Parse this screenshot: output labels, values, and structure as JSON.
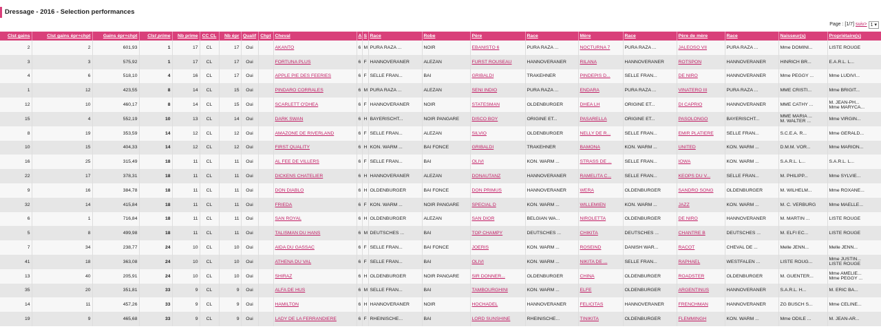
{
  "page": {
    "title": "Dressage - 2016 - Selection performances"
  },
  "pager": {
    "label": "Page : [1/7]",
    "next_label": "suiv>",
    "selected": "1"
  },
  "columns": [
    "Clst gains",
    "Clst gains épr+chpt",
    "Gains épr+chpt",
    "Clst prime",
    "Nb prime",
    "CC CL",
    "Nb épr",
    "Qualif",
    "Chpt",
    "Cheval",
    "A",
    "S",
    "Race",
    "Robe",
    "Père",
    "Race",
    "Mère",
    "Race",
    "Père de mère",
    "Race",
    "Naisseur(s)",
    "Propriétaire(s)"
  ],
  "rows": [
    {
      "clst": "2",
      "clst_ec": "2",
      "gains": "601,93",
      "clst_prime": "1",
      "nb_prime": "17",
      "cc": "CL",
      "nb_epr": "17",
      "qualif": "Oui",
      "chpt": "",
      "cheval": "AKANTO",
      "a": "6",
      "s": "M",
      "race": "PURA RAZA ...",
      "robe": "NOIR",
      "pere": "EBANISTO 6",
      "race_pere": "PURA RAZA ...",
      "mere": "NOCTURNA 7",
      "race_mere": "PURA RAZA ...",
      "pdm": "JALEOSO VII",
      "race_pdm": "PURA RAZA ...",
      "naisseur": "Mme DOMINI...",
      "proprietaire": "LISTE ROUGE"
    },
    {
      "clst": "3",
      "clst_ec": "3",
      "gains": "575,92",
      "clst_prime": "1",
      "nb_prime": "17",
      "cc": "CL",
      "nb_epr": "17",
      "qualif": "Oui",
      "chpt": "",
      "cheval": "FORTUNA PLUS",
      "a": "6",
      "s": "F",
      "race": "HANNOVERANER",
      "robe": "ALEZAN",
      "pere": "FURST ROUSEAU",
      "race_pere": "HANNOVERANER",
      "mere": "RILANA",
      "race_mere": "HANNOVERANER",
      "pdm": "ROTSPON",
      "race_pdm": "HANNOVERANER",
      "naisseur": "HINRICH BR...",
      "proprietaire": "E.A.R.L. L..."
    },
    {
      "clst": "4",
      "clst_ec": "6",
      "gains": "518,10",
      "clst_prime": "4",
      "nb_prime": "16",
      "cc": "CL",
      "nb_epr": "17",
      "qualif": "Oui",
      "chpt": "",
      "cheval": "APPLE PIE DES FEERIES",
      "a": "6",
      "s": "F",
      "race": "SELLE FRAN...",
      "robe": "BAI",
      "pere": "GRIBALDI",
      "race_pere": "TRAKEHNER",
      "mere": "PINDEPIS D...",
      "race_mere": "SELLE FRAN...",
      "pdm": "DE NIRO",
      "race_pdm": "HANNOVERANER",
      "naisseur": "Mme PEGGY ...",
      "proprietaire": "Mme LUDIVI..."
    },
    {
      "clst": "1",
      "clst_ec": "12",
      "gains": "423,55",
      "clst_prime": "8",
      "nb_prime": "14",
      "cc": "CL",
      "nb_epr": "15",
      "qualif": "Oui",
      "chpt": "",
      "cheval": "PINDARO CORRALES",
      "a": "6",
      "s": "M",
      "race": "PURA RAZA ...",
      "robe": "ALEZAN",
      "pere": "SENI INDIO",
      "race_pere": "PURA RAZA ...",
      "mere": "ENDARA",
      "race_mere": "PURA RAZA ...",
      "pdm": "VINATERO III",
      "race_pdm": "PURA RAZA ...",
      "naisseur": "MME CRISTI...",
      "proprietaire": "Mme BRIGIT..."
    },
    {
      "clst": "12",
      "clst_ec": "10",
      "gains": "460,17",
      "clst_prime": "8",
      "nb_prime": "14",
      "cc": "CL",
      "nb_epr": "15",
      "qualif": "Oui",
      "chpt": "",
      "cheval": "SCARLETT O'DHEA",
      "a": "6",
      "s": "F",
      "race": "HANNOVERANER",
      "robe": "NOIR",
      "pere": "STATESMAN",
      "race_pere": "OLDENBURGER",
      "mere": "DHEA LH",
      "race_mere": "ORIGINE ET...",
      "pdm": "DI CAPRIO",
      "race_pdm": "HANNOVERANER",
      "naisseur": "MME CATHY ...",
      "proprietaire": "M. JEAN-PH...|Mme MARYCA..."
    },
    {
      "clst": "15",
      "clst_ec": "4",
      "gains": "552,19",
      "clst_prime": "10",
      "nb_prime": "13",
      "cc": "CL",
      "nb_epr": "14",
      "qualif": "Oui",
      "chpt": "",
      "cheval": "DARK SWAN",
      "a": "6",
      "s": "H",
      "race": "BAYERISCHT...",
      "robe": "NOIR PANGARE",
      "pere": "DISCO BOY",
      "race_pere": "ORIGINE ET...",
      "mere": "PASARELLA",
      "race_mere": "ORIGINE ET...",
      "pdm": "PASOLONGO",
      "race_pdm": "BAYERISCHT...",
      "naisseur": "MME MARIA ...|M. WALTER ...",
      "proprietaire": "Mme VIRGIN..."
    },
    {
      "clst": "8",
      "clst_ec": "19",
      "gains": "353,59",
      "clst_prime": "14",
      "nb_prime": "12",
      "cc": "CL",
      "nb_epr": "12",
      "qualif": "Oui",
      "chpt": "",
      "cheval": "AMAZONE DE RIVERLAND",
      "a": "6",
      "s": "F",
      "race": "SELLE FRAN...",
      "robe": "ALEZAN",
      "pere": "SILVIO",
      "race_pere": "OLDENBURGER",
      "mere": "NELLY DE R...",
      "race_mere": "SELLE FRAN...",
      "pdm": "EMIR PLATIERE",
      "race_pdm": "SELLE FRAN...",
      "naisseur": "S.C.E.A. R...",
      "proprietaire": "Mme GERALD..."
    },
    {
      "clst": "10",
      "clst_ec": "15",
      "gains": "404,33",
      "clst_prime": "14",
      "nb_prime": "12",
      "cc": "CL",
      "nb_epr": "12",
      "qualif": "Oui",
      "chpt": "",
      "cheval": "FIRST QUALITY",
      "a": "6",
      "s": "H",
      "race": "KON. WARM ...",
      "robe": "BAI FONCE",
      "pere": "GRIBALDI",
      "race_pere": "TRAKEHNER",
      "mere": "BAMONA",
      "race_mere": "KON. WARM ...",
      "pdm": "UNITED",
      "race_pdm": "KON. WARM ...",
      "naisseur": "D.M.M. VOR...",
      "proprietaire": "Mme MARION..."
    },
    {
      "clst": "16",
      "clst_ec": "25",
      "gains": "315,49",
      "clst_prime": "18",
      "nb_prime": "11",
      "cc": "CL",
      "nb_epr": "11",
      "qualif": "Oui",
      "chpt": "",
      "cheval": "AL FEE DE VILLERS",
      "a": "6",
      "s": "F",
      "race": "SELLE FRAN...",
      "robe": "BAI",
      "pere": "OLIVI",
      "race_pere": "KON. WARM ...",
      "mere": "STRASS DE ...",
      "race_mere": "SELLE FRAN...",
      "pdm": "IOWA",
      "race_pdm": "KON. WARM ...",
      "naisseur": "S.A.R.L. L...",
      "proprietaire": "S.A.R.L. L..."
    },
    {
      "clst": "22",
      "clst_ec": "17",
      "gains": "378,31",
      "clst_prime": "18",
      "nb_prime": "11",
      "cc": "CL",
      "nb_epr": "11",
      "qualif": "Oui",
      "chpt": "",
      "cheval": "DICKENS CHATELIER",
      "a": "6",
      "s": "H",
      "race": "HANNOVERANER",
      "robe": "ALEZAN",
      "pere": "DONAUTANZ",
      "race_pere": "HANNOVERANER",
      "mere": "RAMELITA C...",
      "race_mere": "SELLE FRAN...",
      "pdm": "KEOPS DU V...",
      "race_pdm": "SELLE FRAN...",
      "naisseur": "M. PHILIPP...",
      "proprietaire": "Mme SYLVIE..."
    },
    {
      "clst": "9",
      "clst_ec": "16",
      "gains": "384,78",
      "clst_prime": "18",
      "nb_prime": "11",
      "cc": "CL",
      "nb_epr": "11",
      "qualif": "Oui",
      "chpt": "",
      "cheval": "DON DIABLO",
      "a": "6",
      "s": "H",
      "race": "OLDENBURGER",
      "robe": "BAI FONCE",
      "pere": "DON PRIMUS",
      "race_pere": "HANNOVERANER",
      "mere": "WERA",
      "race_mere": "OLDENBURGER",
      "pdm": "SANDRO SONG",
      "race_pdm": "OLDENBURGER",
      "naisseur": "M. WILHELM...",
      "proprietaire": "Mme ROXANE..."
    },
    {
      "clst": "32",
      "clst_ec": "14",
      "gains": "415,84",
      "clst_prime": "18",
      "nb_prime": "11",
      "cc": "CL",
      "nb_epr": "11",
      "qualif": "Oui",
      "chpt": "",
      "cheval": "FRIEDA",
      "a": "6",
      "s": "F",
      "race": "KON. WARM ...",
      "robe": "NOIR PANGARE",
      "pere": "SPECIAL D",
      "race_pere": "KON. WARM ...",
      "mere": "WILLEMIEN",
      "race_mere": "KON. WARM ...",
      "pdm": "JAZZ",
      "race_pdm": "KON. WARM ...",
      "naisseur": "M. C. VERBURG",
      "proprietaire": "Mme MAELLE..."
    },
    {
      "clst": "6",
      "clst_ec": "1",
      "gains": "716,84",
      "clst_prime": "18",
      "nb_prime": "11",
      "cc": "CL",
      "nb_epr": "11",
      "qualif": "Oui",
      "chpt": "",
      "cheval": "SAN ROYAL",
      "a": "6",
      "s": "H",
      "race": "OLDENBURGER",
      "robe": "ALEZAN",
      "pere": "SAN DIOR",
      "race_pere": "BELGIAN WA...",
      "mere": "NIROLETTA",
      "race_mere": "OLDENBURGER",
      "pdm": "DE NIRO",
      "race_pdm": "HANNOVERANER",
      "naisseur": "M. MARTIN ...",
      "proprietaire": "LISTE ROUGE"
    },
    {
      "clst": "5",
      "clst_ec": "8",
      "gains": "499,98",
      "clst_prime": "18",
      "nb_prime": "11",
      "cc": "CL",
      "nb_epr": "11",
      "qualif": "Oui",
      "chpt": "",
      "cheval": "TALISMAN DU HANS",
      "a": "6",
      "s": "M",
      "race": "DEUTSCHES ...",
      "robe": "BAI",
      "pere": "TOP CHAMPY",
      "race_pere": "DEUTSCHES ...",
      "mere": "CHIKITA",
      "race_mere": "DEUTSCHES ...",
      "pdm": "CHANTRE B",
      "race_pdm": "DEUTSCHES ...",
      "naisseur": "M. ELFI EC...",
      "proprietaire": "LISTE ROUGE"
    },
    {
      "clst": "7",
      "clst_ec": "34",
      "gains": "238,77",
      "clst_prime": "24",
      "nb_prime": "10",
      "cc": "CL",
      "nb_epr": "10",
      "qualif": "Oui",
      "chpt": "",
      "cheval": "AIDA DU GASSAC",
      "a": "6",
      "s": "F",
      "race": "SELLE FRAN...",
      "robe": "BAI FONCE",
      "pere": "JOERIS",
      "race_pere": "KON. WARM ...",
      "mere": "ROSEIND",
      "race_mere": "DANISH WAR...",
      "pdm": "RACOT",
      "race_pdm": "CHEVAL DE ...",
      "naisseur": "Melle JENN...",
      "proprietaire": "Melle JENN..."
    },
    {
      "clst": "41",
      "clst_ec": "18",
      "gains": "363,08",
      "clst_prime": "24",
      "nb_prime": "10",
      "cc": "CL",
      "nb_epr": "10",
      "qualif": "Oui",
      "chpt": "",
      "cheval": "ATHENA DU VAL",
      "a": "6",
      "s": "F",
      "race": "SELLE FRAN...",
      "robe": "BAI",
      "pere": "OLIVI",
      "race_pere": "KON. WARM ...",
      "mere": "NIKITA DE ...",
      "race_mere": "SELLE FRAN...",
      "pdm": "RAPHAEL",
      "race_pdm": "WESTFALEN ...",
      "naisseur": "LISTE ROUG...",
      "proprietaire": "Mme JUSTIN...|LISTE ROUGE"
    },
    {
      "clst": "13",
      "clst_ec": "40",
      "gains": "205,91",
      "clst_prime": "24",
      "nb_prime": "10",
      "cc": "CL",
      "nb_epr": "10",
      "qualif": "Oui",
      "chpt": "",
      "cheval": "SHIRAZ",
      "a": "6",
      "s": "H",
      "race": "OLDENBURGER",
      "robe": "NOIR PANGARE",
      "pere": "SIR DONNER...",
      "race_pere": "OLDENBURGER",
      "mere": "CHINA",
      "race_mere": "OLDENBURGER",
      "pdm": "ROADSTER",
      "race_pdm": "OLDENBURGER",
      "naisseur": "M. GUENTER...",
      "proprietaire": "Mme AMELIE...|Mme PEGGY ..."
    },
    {
      "clst": "35",
      "clst_ec": "20",
      "gains": "351,81",
      "clst_prime": "33",
      "nb_prime": "9",
      "cc": "CL",
      "nb_epr": "9",
      "qualif": "Oui",
      "chpt": "",
      "cheval": "ALFA DE HUS",
      "a": "6",
      "s": "M",
      "race": "SELLE FRAN...",
      "robe": "BAI",
      "pere": "TAMBOURGHINI",
      "race_pere": "KON. WARM ...",
      "mere": "ELFE",
      "race_mere": "OLDENBURGER",
      "pdm": "ARGENTINUS",
      "race_pdm": "HANNOVERANER",
      "naisseur": "S.A.R.L. H...",
      "proprietaire": "M. ERIC BA..."
    },
    {
      "clst": "14",
      "clst_ec": "11",
      "gains": "457,26",
      "clst_prime": "33",
      "nb_prime": "9",
      "cc": "CL",
      "nb_epr": "9",
      "qualif": "Oui",
      "chpt": "",
      "cheval": "HAMILTON",
      "a": "6",
      "s": "H",
      "race": "HANNOVERANER",
      "robe": "NOIR",
      "pere": "HOCHADEL",
      "race_pere": "HANNOVERANER",
      "mere": "FELICITAS",
      "race_mere": "HANNOVERANER",
      "pdm": "FRENCHMAN",
      "race_pdm": "HANNOVERANER",
      "naisseur": "ZG BUSCH S...",
      "proprietaire": "Mme CELINE..."
    },
    {
      "clst": "19",
      "clst_ec": "9",
      "gains": "465,68",
      "clst_prime": "33",
      "nb_prime": "9",
      "cc": "CL",
      "nb_epr": "9",
      "qualif": "Oui",
      "chpt": "",
      "cheval": "LADY DE LA FERRANDIERE",
      "a": "6",
      "s": "F",
      "race": "RHEINISCHE...",
      "robe": "BAI",
      "pere": "LORD SUNSHINE",
      "race_pere": "RHEINISCHE...",
      "mere": "TINIKITA",
      "race_mere": "OLDENBURGER",
      "pdm": "FLEMMINGH",
      "race_pdm": "KON. WARM ...",
      "naisseur": "Mme ODILE ...",
      "proprietaire": "M. JEAN-AR..."
    }
  ]
}
